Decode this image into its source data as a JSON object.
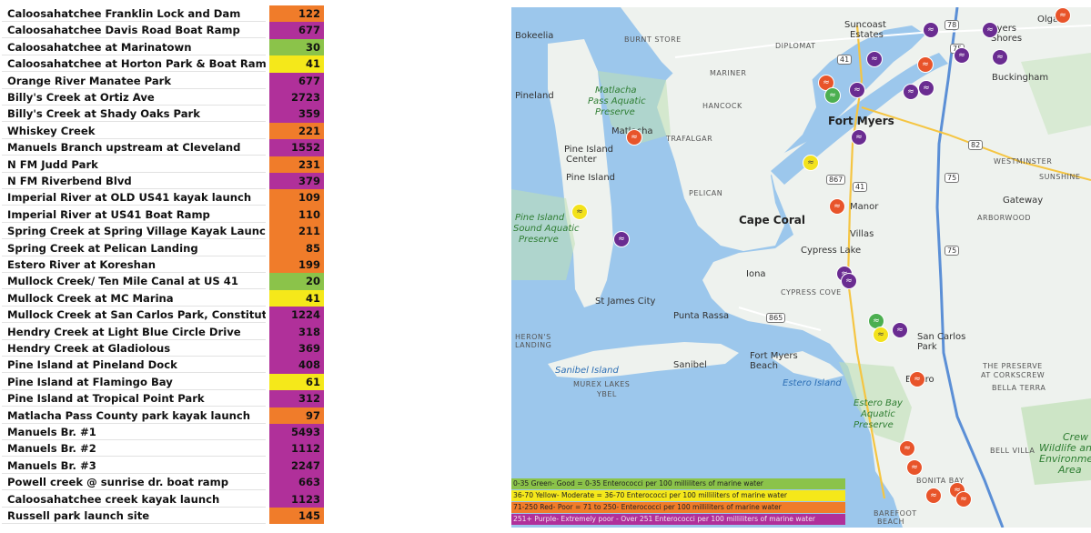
{
  "colors": {
    "green": "#8bc34a",
    "yellow": "#f5e81a",
    "red": "#f07c2a",
    "purple": "#b0309a",
    "marker_purple": "#6a2c91",
    "marker_red": "#e8542a",
    "marker_yellow": "#f3e21c",
    "marker_green": "#4caf50",
    "water": "#9cc7ec",
    "land": "#eef2ee",
    "park": "#bfe0b5"
  },
  "sites": [
    {
      "name": "Caloosahatchee Franklin Lock and Dam",
      "value": "122",
      "level": "red"
    },
    {
      "name": "Caloosahatchee Davis Road Boat Ramp",
      "value": "677",
      "level": "purple"
    },
    {
      "name": "Caloosahatchee at Marinatown",
      "value": "30",
      "level": "green"
    },
    {
      "name": "Caloosahatchee at Horton Park & Boat Ramp",
      "value": "41",
      "level": "yellow"
    },
    {
      "name": "Orange River Manatee Park",
      "value": "677",
      "level": "purple"
    },
    {
      "name": "Billy's Creek at Ortiz Ave",
      "value": "2723",
      "level": "purple"
    },
    {
      "name": "Billy's Creek at Shady Oaks Park",
      "value": "359",
      "level": "purple"
    },
    {
      "name": "Whiskey Creek",
      "value": "221",
      "level": "red"
    },
    {
      "name": "Manuels Branch upstream at Cleveland",
      "value": "1552",
      "level": "purple"
    },
    {
      "name": "N FM Judd Park",
      "value": "231",
      "level": "red"
    },
    {
      "name": "N FM Riverbend Blvd",
      "value": "379",
      "level": "purple"
    },
    {
      "name": "Imperial River at OLD US41 kayak launch",
      "value": "109",
      "level": "red"
    },
    {
      "name": "Imperial River at US41 Boat Ramp",
      "value": "110",
      "level": "red"
    },
    {
      "name": "Spring Creek at Spring Village Kayak Launch",
      "value": "211",
      "level": "red"
    },
    {
      "name": "Spring Creek at Pelican Landing",
      "value": "85",
      "level": "red"
    },
    {
      "name": "Estero River at Koreshan",
      "value": "199",
      "level": "red"
    },
    {
      "name": "Mullock Creek/ Ten Mile Canal at US 41",
      "value": "20",
      "level": "green"
    },
    {
      "name": "Mullock Creek at MC Marina",
      "value": "41",
      "level": "yellow"
    },
    {
      "name": "Mullock Creek at San Carlos Park, Constitution",
      "value": "1224",
      "level": "purple"
    },
    {
      "name": "Hendry Creek at Light Blue Circle Drive",
      "value": "318",
      "level": "purple"
    },
    {
      "name": "Hendry Creek at Gladiolous",
      "value": "369",
      "level": "purple"
    },
    {
      "name": "Pine Island at Pineland Dock",
      "value": "408",
      "level": "purple"
    },
    {
      "name": "Pine Island at Flamingo Bay",
      "value": "61",
      "level": "yellow"
    },
    {
      "name": "Pine Island at Tropical Point Park",
      "value": "312",
      "level": "purple"
    },
    {
      "name": "Matlacha Pass County park kayak launch",
      "value": "97",
      "level": "red"
    },
    {
      "name": "Manuels Br. #1",
      "value": "5493",
      "level": "purple"
    },
    {
      "name": "Manuels Br. #2",
      "value": "1112",
      "level": "purple"
    },
    {
      "name": "Manuels Br. #3",
      "value": "2247",
      "level": "purple"
    },
    {
      "name": "Powell creek @ sunrise dr. boat ramp",
      "value": "663",
      "level": "purple"
    },
    {
      "name": "Caloosahatchee creek kayak launch",
      "value": "1123",
      "level": "purple"
    },
    {
      "name": "Russell park launch site",
      "value": "145",
      "level": "red"
    }
  ],
  "legend": [
    {
      "text": "0-35  Green- Good = 0-35 Enterococci per 100 milliliters of marine water",
      "level": "green"
    },
    {
      "text": "36-70   Yellow- Moderate = 36-70 Enterococci per 100 milliliters of marine water",
      "level": "yellow"
    },
    {
      "text": "71-250   Red- Poor = 71 to 250-  Enterococci per 100 milliliters of marine water",
      "level": "red"
    },
    {
      "text": "251+  Purple- Extremely poor - Over 251 Enterococci per 100 milliliters of marine water",
      "level": "purple"
    }
  ],
  "map": {
    "places": [
      {
        "text": "Suncoast",
        "style": "plain"
      },
      {
        "text": "Estates",
        "style": "plain"
      },
      {
        "text": "Olga",
        "style": "plain"
      },
      {
        "text": "Bokeelia",
        "style": "plain"
      },
      {
        "text": "BURNT STORE",
        "style": "caps"
      },
      {
        "text": "DIPLOMAT",
        "style": "caps"
      },
      {
        "text": "Myers",
        "style": "plain"
      },
      {
        "text": "Shores",
        "style": "plain"
      },
      {
        "text": "MARINER",
        "style": "caps"
      },
      {
        "text": "Buckingham",
        "style": "plain"
      },
      {
        "text": "Pineland",
        "style": "plain"
      },
      {
        "text": "Matlacha",
        "style": "park"
      },
      {
        "text": "Pass Aquatic",
        "style": "park"
      },
      {
        "text": "Preserve",
        "style": "park"
      },
      {
        "text": "HANCOCK",
        "style": "caps"
      },
      {
        "text": "Fort Myers",
        "style": "city"
      },
      {
        "text": "Matlacha",
        "style": "plain"
      },
      {
        "text": "TRAFALGAR",
        "style": "caps"
      },
      {
        "text": "Pine Island",
        "style": "plain"
      },
      {
        "text": "Center",
        "style": "plain"
      },
      {
        "text": "WESTMINSTER",
        "style": "caps"
      },
      {
        "text": "SUNSHINE",
        "style": "caps"
      },
      {
        "text": "Pine Island",
        "style": "plain"
      },
      {
        "text": "PELICAN",
        "style": "caps"
      },
      {
        "text": "Gateway",
        "style": "plain"
      },
      {
        "text": "Pine Island",
        "style": "park"
      },
      {
        "text": "Sound Aquatic",
        "style": "park"
      },
      {
        "text": "Preserve",
        "style": "park"
      },
      {
        "text": "Cape Coral",
        "style": "city"
      },
      {
        "text": "Manor",
        "style": "plain"
      },
      {
        "text": "Villas",
        "style": "plain"
      },
      {
        "text": "ARBORWOOD",
        "style": "caps"
      },
      {
        "text": "Cypress Lake",
        "style": "plain"
      },
      {
        "text": "Iona",
        "style": "plain"
      },
      {
        "text": "CYPRESS COVE",
        "style": "caps"
      },
      {
        "text": "St James City",
        "style": "plain"
      },
      {
        "text": "Punta Rassa",
        "style": "plain"
      },
      {
        "text": "HERON'S",
        "style": "caps"
      },
      {
        "text": "LANDING",
        "style": "caps"
      },
      {
        "text": "San Carlos",
        "style": "plain"
      },
      {
        "text": "Park",
        "style": "plain"
      },
      {
        "text": "Fort Myers",
        "style": "plain"
      },
      {
        "text": "Beach",
        "style": "plain"
      },
      {
        "text": "Sanibel",
        "style": "plain"
      },
      {
        "text": "Sanibel Island",
        "style": "water"
      },
      {
        "text": "MUREX LAKES",
        "style": "caps"
      },
      {
        "text": "YBEL",
        "style": "caps"
      },
      {
        "text": "Estero Island",
        "style": "water"
      },
      {
        "text": "Estero",
        "style": "plain"
      },
      {
        "text": "THE PRESERVE",
        "style": "caps"
      },
      {
        "text": "AT CORKSCREW",
        "style": "caps"
      },
      {
        "text": "BELLA TERRA",
        "style": "caps"
      },
      {
        "text": "Estero Bay",
        "style": "park"
      },
      {
        "text": "Aquatic",
        "style": "park"
      },
      {
        "text": "Preserve",
        "style": "park"
      },
      {
        "text": "Crew",
        "style": "parkbig"
      },
      {
        "text": "Wildlife and",
        "style": "parkbig"
      },
      {
        "text": "Environment",
        "style": "parkbig"
      },
      {
        "text": "Area",
        "style": "parkbig"
      },
      {
        "text": "BELL VILLA",
        "style": "caps"
      },
      {
        "text": "BONITA BAY",
        "style": "caps"
      },
      {
        "text": "BAREFOOT",
        "style": "caps"
      },
      {
        "text": "BEACH",
        "style": "caps"
      }
    ],
    "roads": [
      "78",
      "41",
      "75",
      "82",
      "867",
      "41",
      "75",
      "865",
      "75"
    ],
    "markers": [
      {
        "color": "red",
        "icon": "swimmer-icon"
      },
      {
        "color": "purple",
        "icon": "swimmer-icon"
      },
      {
        "color": "purple",
        "icon": "swimmer-icon"
      },
      {
        "color": "purple",
        "icon": "swimmer-icon"
      },
      {
        "color": "red",
        "icon": "swimmer-icon"
      },
      {
        "color": "purple",
        "icon": "swimmer-icon"
      },
      {
        "color": "purple",
        "icon": "swimmer-icon"
      },
      {
        "color": "red",
        "icon": "swimmer-icon"
      },
      {
        "color": "green",
        "icon": "swimmer-icon"
      },
      {
        "color": "purple",
        "icon": "swimmer-icon"
      },
      {
        "color": "purple",
        "icon": "swimmer-icon"
      },
      {
        "color": "purple",
        "icon": "swimmer-icon"
      },
      {
        "color": "red",
        "icon": "swimmer-icon"
      },
      {
        "color": "purple",
        "icon": "swimmer-icon"
      },
      {
        "color": "yellow",
        "icon": "swimmer-icon"
      },
      {
        "color": "yellow",
        "icon": "swimmer-icon"
      },
      {
        "color": "red",
        "icon": "swimmer-icon"
      },
      {
        "color": "purple",
        "icon": "swimmer-icon"
      },
      {
        "color": "purple",
        "icon": "swimmer-icon"
      },
      {
        "color": "purple",
        "icon": "swimmer-icon"
      },
      {
        "color": "green",
        "icon": "swimmer-icon"
      },
      {
        "color": "yellow",
        "icon": "swimmer-icon"
      },
      {
        "color": "purple",
        "icon": "swimmer-icon"
      },
      {
        "color": "red",
        "icon": "swimmer-icon"
      },
      {
        "color": "red",
        "icon": "swimmer-icon"
      },
      {
        "color": "red",
        "icon": "swimmer-icon"
      },
      {
        "color": "red",
        "icon": "swimmer-icon"
      },
      {
        "color": "red",
        "icon": "swimmer-icon"
      },
      {
        "color": "red",
        "icon": "swimmer-icon"
      }
    ]
  }
}
